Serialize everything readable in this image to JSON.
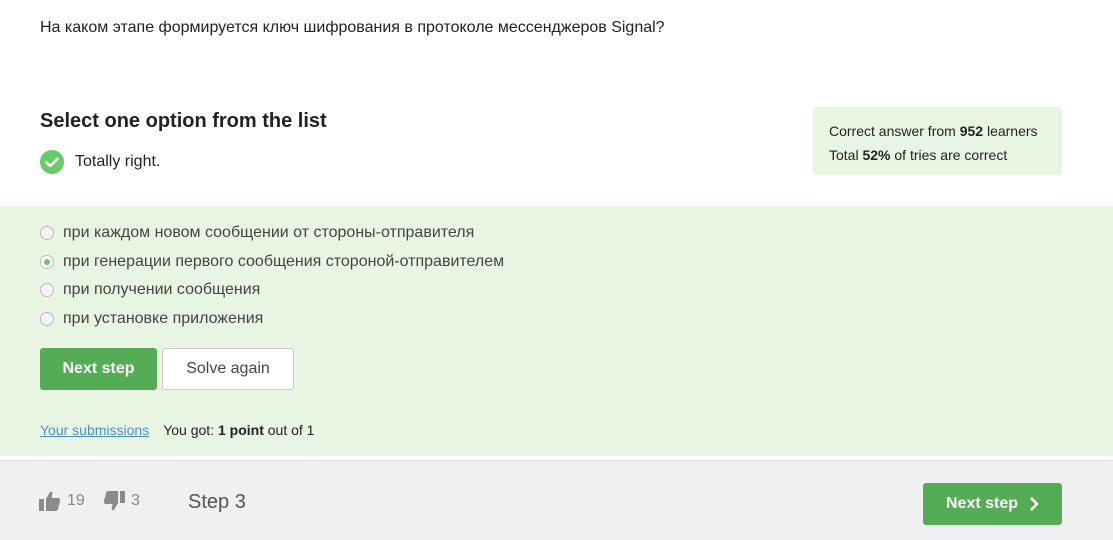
{
  "question": {
    "text": "На каком этапе формируется ключ шифрования в протоколе мессенджеров Signal?"
  },
  "quiz": {
    "instruction": "Select one option from the list",
    "result_text": "Totally right.",
    "result_icon": "check-circle-icon"
  },
  "stats": {
    "line1_prefix": "Correct answer from ",
    "learners_count": "952",
    "line1_suffix": " learners",
    "line2_prefix": "Total ",
    "correct_percent": "52%",
    "line2_suffix": " of tries are correct"
  },
  "options": [
    {
      "label": "при каждом новом сообщении от стороны-отправителя",
      "selected": false
    },
    {
      "label": "при генерации первого сообщения стороной-отправителем",
      "selected": true
    },
    {
      "label": "при получении сообщения",
      "selected": false
    },
    {
      "label": "при установке приложения",
      "selected": false
    }
  ],
  "actions": {
    "next_step_label": "Next step",
    "solve_again_label": "Solve again"
  },
  "submissions": {
    "link_text": "Your submissions",
    "score_prefix": "You got: ",
    "score_value": "1 point",
    "score_suffix": " out of 1"
  },
  "footer": {
    "likes": "19",
    "dislikes": "3",
    "step_label": "Step 3",
    "next_step_label": "Next step"
  },
  "colors": {
    "accent_green": "#54ad54",
    "panel_green": "#e9f5e3",
    "check_green": "#66cc66",
    "link_blue": "#4a8fd9"
  }
}
